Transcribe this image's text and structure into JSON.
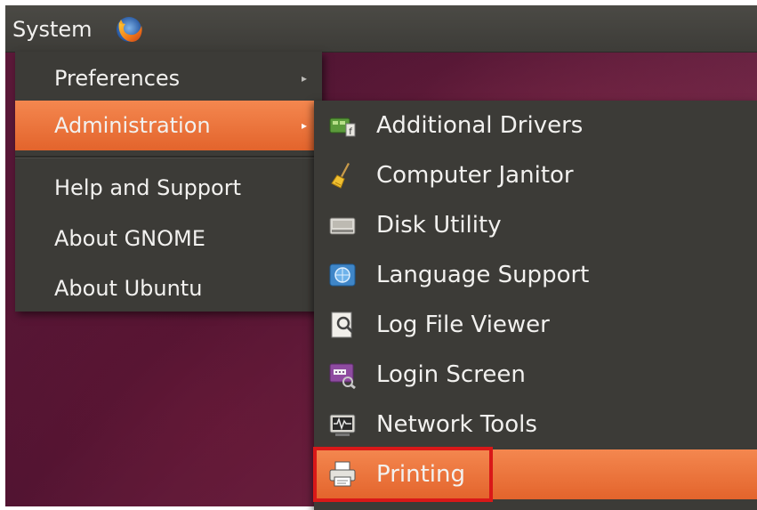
{
  "panel": {
    "system_label": "System",
    "browser_icon": "firefox-icon"
  },
  "main_menu": {
    "items": [
      {
        "label": "Preferences",
        "has_submenu": true
      },
      {
        "label": "Administration",
        "has_submenu": true,
        "active": true
      },
      {
        "label": "Help and Support",
        "has_submenu": false
      },
      {
        "label": "About GNOME",
        "has_submenu": false
      },
      {
        "label": "About Ubuntu",
        "has_submenu": false
      }
    ],
    "submenu_arrow": "▸"
  },
  "admin_submenu": {
    "items": [
      {
        "label": "Additional Drivers",
        "icon": "additional-drivers-icon"
      },
      {
        "label": "Computer Janitor",
        "icon": "broom-icon"
      },
      {
        "label": "Disk Utility",
        "icon": "disk-icon"
      },
      {
        "label": "Language Support",
        "icon": "language-icon"
      },
      {
        "label": "Log File Viewer",
        "icon": "log-viewer-icon"
      },
      {
        "label": "Login Screen",
        "icon": "login-screen-icon"
      },
      {
        "label": "Network Tools",
        "icon": "network-tools-icon"
      },
      {
        "label": "Printing",
        "icon": "printer-icon",
        "active": true,
        "highlighted": true
      }
    ]
  },
  "colors": {
    "menu_bg": "#3c3b37",
    "highlight": "#e8703a",
    "annotation_border": "#d91818",
    "text": "#f2f1ef"
  }
}
